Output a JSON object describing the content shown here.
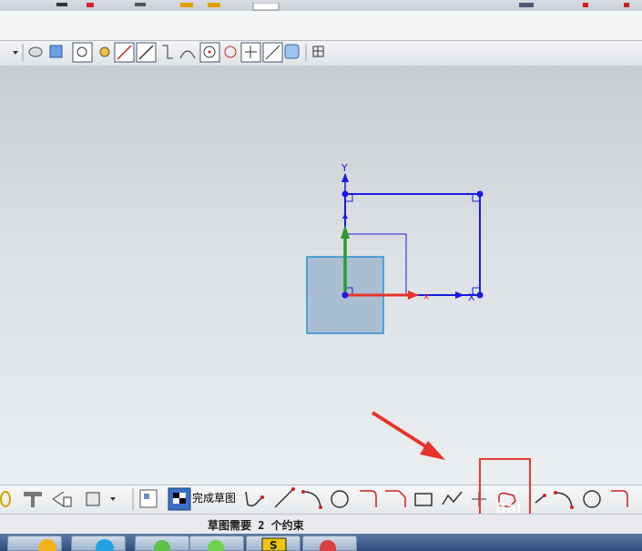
{
  "toolbar": {
    "finish_sketch_label": "完成草图"
  },
  "canvas": {
    "axis_y_label": "Y",
    "axis_x_label": "X"
  },
  "status": {
    "message": "草图需要 2 个约束"
  },
  "watermark": {
    "text": "Bai"
  },
  "colors": {
    "sketch_blue": "#1a1ae0",
    "highlight_red": "#e53b2e",
    "arrow_red": "#e8332a",
    "axis_green": "#2e9a2e"
  }
}
